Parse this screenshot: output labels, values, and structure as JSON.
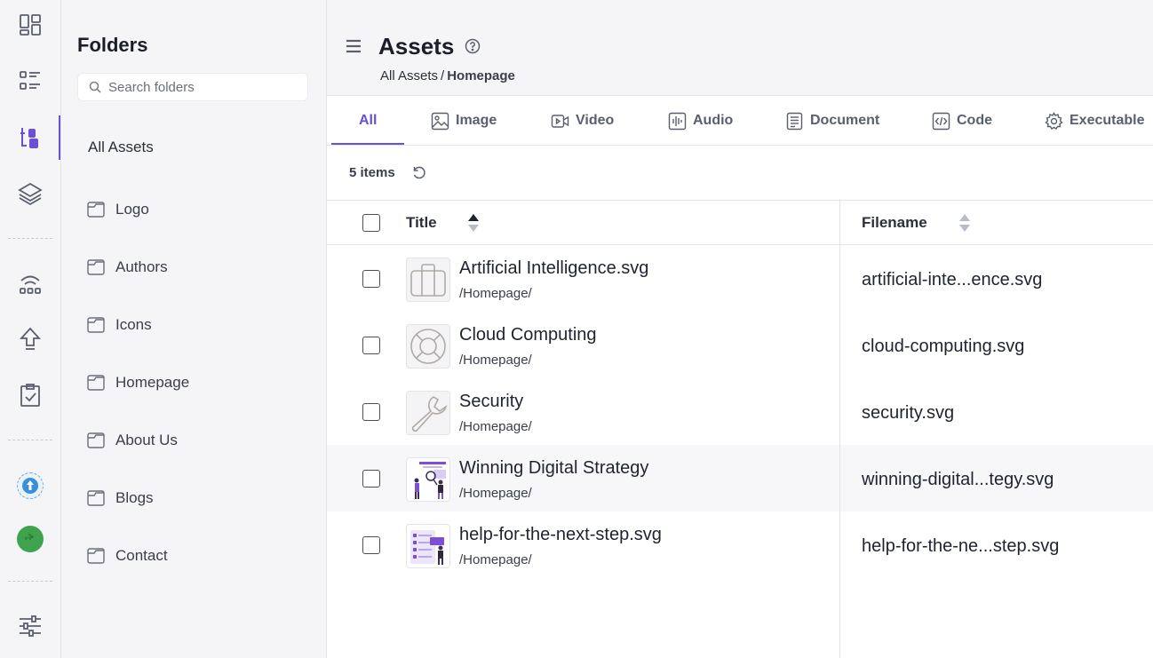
{
  "rail": {
    "items": [
      {
        "icon": "dashboard-icon"
      },
      {
        "icon": "list-icon"
      },
      {
        "icon": "assets-icon",
        "active": true
      },
      {
        "icon": "layers-icon"
      },
      {
        "icon": "wifi-network-icon"
      },
      {
        "icon": "upload-icon"
      },
      {
        "icon": "clipboard-check-icon"
      },
      {
        "icon": "upload-app-icon"
      },
      {
        "icon": "plugin-icon"
      },
      {
        "icon": "settings-sliders-icon"
      }
    ],
    "accent": "#6b4fd8"
  },
  "folders": {
    "title": "Folders",
    "search_placeholder": "Search folders",
    "all_assets": "All Assets",
    "items": [
      "Logo",
      "Authors",
      "Icons",
      "Homepage",
      "About Us",
      "Blogs",
      "Contact"
    ]
  },
  "header": {
    "title": "Assets",
    "breadcrumb": {
      "root": "All Assets",
      "separator": "/",
      "current": "Homepage"
    }
  },
  "tabs": [
    {
      "label": "All",
      "icon": "",
      "active": true
    },
    {
      "label": "Image",
      "icon": "image-icon"
    },
    {
      "label": "Video",
      "icon": "video-icon"
    },
    {
      "label": "Audio",
      "icon": "audio-icon"
    },
    {
      "label": "Document",
      "icon": "document-icon"
    },
    {
      "label": "Code",
      "icon": "code-icon"
    },
    {
      "label": "Executable",
      "icon": "gear-icon"
    }
  ],
  "toolbar": {
    "item_count": "5 items"
  },
  "table": {
    "columns": {
      "title": "Title",
      "filename": "Filename"
    },
    "rows": [
      {
        "title": "Artificial Intelligence.svg",
        "path": "/Homepage/",
        "filename": "artificial-inte...ence.svg",
        "thumb": "briefcase-icon"
      },
      {
        "title": "Cloud Computing",
        "path": "/Homepage/",
        "filename": "cloud-computing.svg",
        "thumb": "lifebuoy-icon"
      },
      {
        "title": "Security",
        "path": "/Homepage/",
        "filename": "security.svg",
        "thumb": "wrench-icon"
      },
      {
        "title": "Winning Digital Strategy",
        "path": "/Homepage/",
        "filename": "winning-digital...tegy.svg",
        "thumb": "strategy-illustration"
      },
      {
        "title": "help-for-the-next-step.svg",
        "path": "/Homepage/",
        "filename": "help-for-the-ne...step.svg",
        "thumb": "help-illustration"
      }
    ]
  }
}
